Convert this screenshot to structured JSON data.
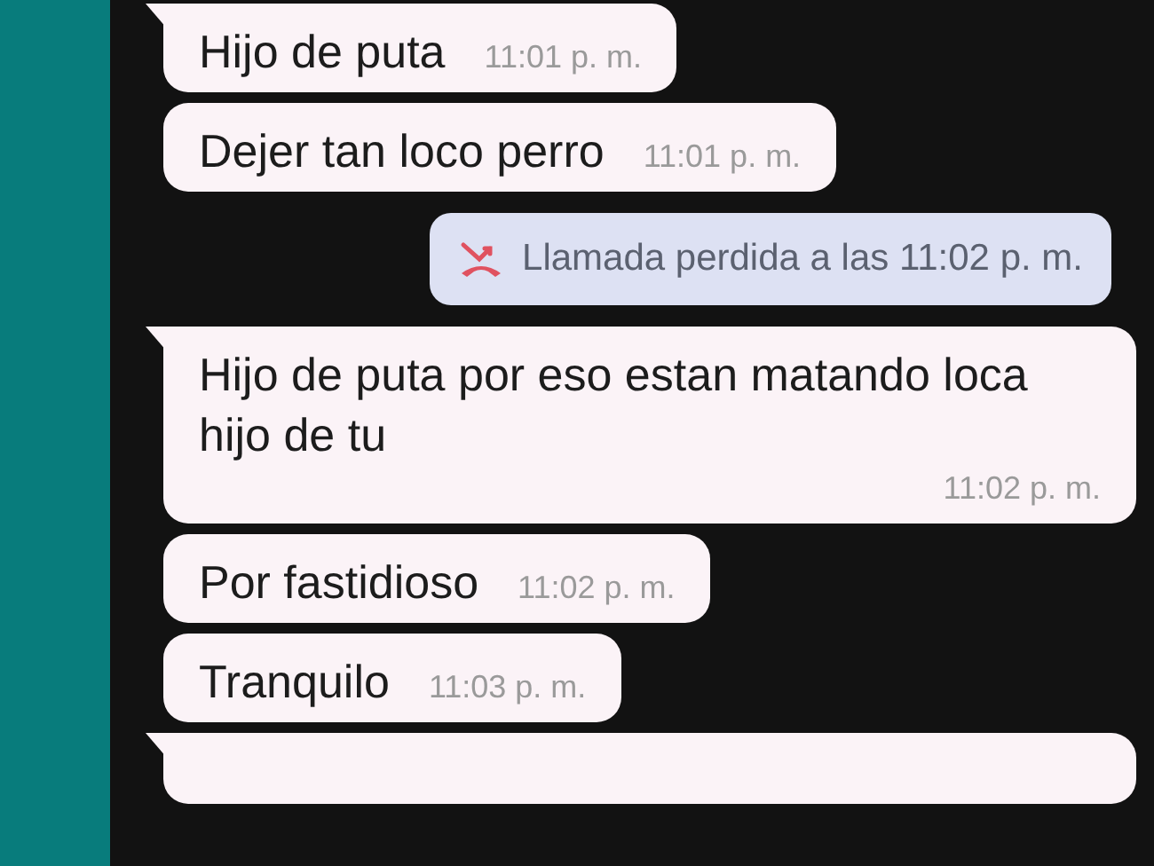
{
  "messages": [
    {
      "kind": "incoming",
      "tail": true,
      "text": "Hijo de puta",
      "time": "11:01 p. m."
    },
    {
      "kind": "incoming",
      "tail": false,
      "text": "Dejer tan loco perro",
      "time": "11:01 p. m."
    },
    {
      "kind": "missed_call",
      "text": "Llamada perdida a las 11:02 p. m."
    },
    {
      "kind": "incoming",
      "tail": true,
      "text": "Hijo de puta por eso estan matando loca hijo de tu",
      "time": "11:02 p. m."
    },
    {
      "kind": "incoming",
      "tail": false,
      "text": "Por fastidioso",
      "time": "11:02 p. m."
    },
    {
      "kind": "incoming",
      "tail": false,
      "text": "Tranquilo",
      "time": "11:03 p. m."
    },
    {
      "kind": "cut_off",
      "tail": true
    }
  ]
}
